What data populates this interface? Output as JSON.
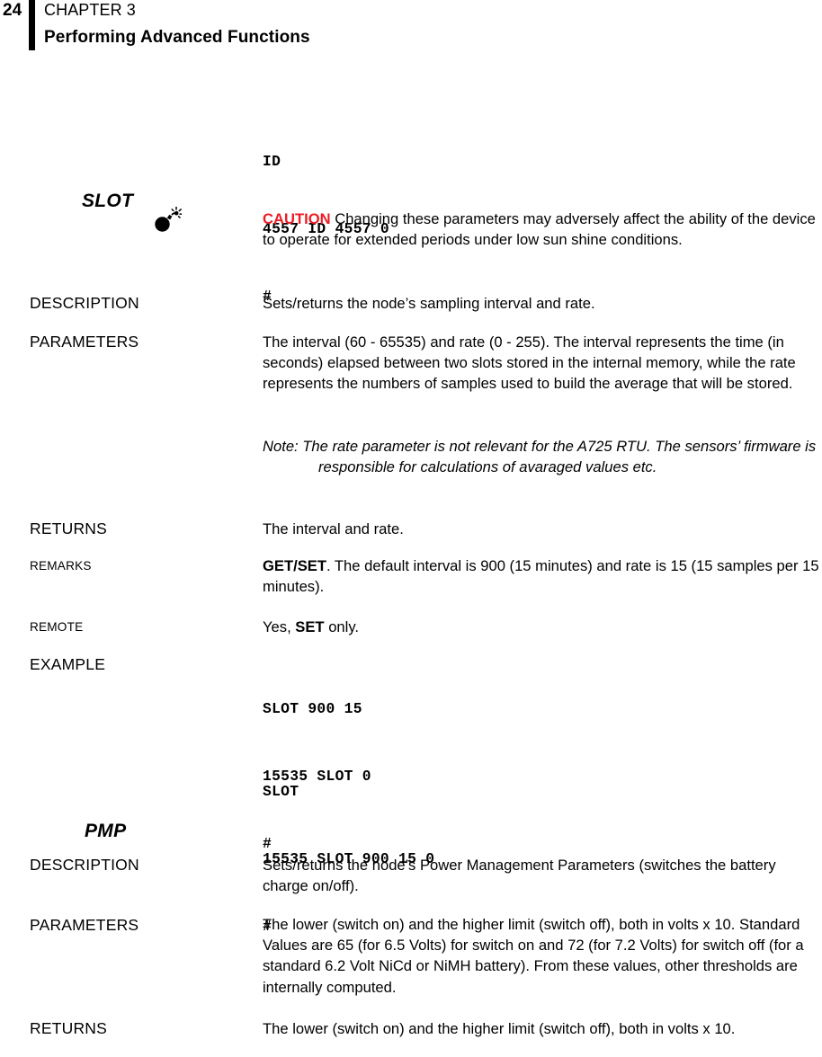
{
  "header": {
    "folio": "24",
    "chapter_label": "CHAPTER 3",
    "chapter_title": "Performing Advanced Functions",
    "rule_color": "#000000"
  },
  "colors": {
    "caution_red": "#ed1c24",
    "text": "#000000",
    "background": "#ffffff"
  },
  "top_code_block": {
    "line1": "ID",
    "line2": "4557 ID 4557 0",
    "line3": "#"
  },
  "sections": [
    {
      "heading": "SLOT",
      "caution": {
        "icon": "bomb-icon",
        "word": "CAUTION",
        "text": " Changing these parameters may adversely affect the ability of the device to operate for extended periods under low sun shine conditions."
      },
      "rows": [
        {
          "label": "DESCRIPTION",
          "label_style": "small-caps",
          "body": "Sets/returns the node’s sampling interval and rate."
        },
        {
          "label": "PARAMETERS",
          "label_style": "small-caps",
          "body": "The interval (60 - 65535) and rate (0 - 255). The interval represents the time (in seconds) elapsed between two slots stored in the internal memory, while the rate represents the numbers of samples used to build the average that will be stored.",
          "note": "Note: The rate parameter is not relevant for the A725 RTU. The sensors’ firmware is responsible for calculations of avaraged values etc."
        },
        {
          "label": "RETURNS",
          "label_style": "small-caps",
          "body": "The interval and rate."
        },
        {
          "label": "REMARKS",
          "label_style": "flat-caps",
          "body_bold": "GET/SET",
          "body": ". The default interval is 900 (15 minutes) and rate is 15 (15 samples per 15 minutes)."
        },
        {
          "label": "REMOTE",
          "label_style": "flat-caps",
          "body_prefix": "Yes, ",
          "body_bold": "SET",
          "body_suffix": " only."
        },
        {
          "label": "EXAMPLE",
          "label_style": "small-caps",
          "code_block_1": {
            "line1": "SLOT 900 15",
            "line2": "15535 SLOT 0",
            "line3": "#"
          },
          "code_block_2": {
            "line1": "SLOT",
            "line2": "15535 SLOT 900 15 0",
            "line3": "#"
          }
        }
      ]
    },
    {
      "heading": "PMP",
      "rows": [
        {
          "label": "DESCRIPTION",
          "label_style": "small-caps",
          "body": "Sets/returns the node’s Power Management Parameters (switches the battery charge on/off)."
        },
        {
          "label": "PARAMETERS",
          "label_style": "small-caps",
          "body": "The lower (switch on) and the higher limit (switch off), both in volts x 10. Standard Values are 65 (for 6.5 Volts) for switch on and 72 (for 7.2 Volts) for switch off (for a standard 6.2 Volt NiCd or NiMH battery). From these values, other thresholds are internally computed."
        },
        {
          "label": "RETURNS",
          "label_style": "small-caps",
          "body": "The lower (switch on) and the higher limit (switch off), both in volts x 10."
        }
      ]
    }
  ]
}
